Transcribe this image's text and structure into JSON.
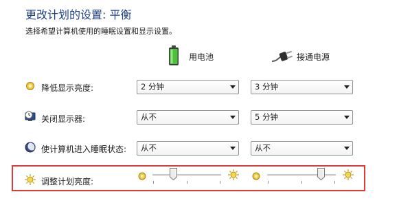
{
  "header": {
    "title": "更改计划的设置: 平衡",
    "subtitle": "选择希望计算机使用的睡眠设置和显示设置。"
  },
  "columns": {
    "battery": {
      "label": "用电池",
      "icon": "battery-icon"
    },
    "plugged": {
      "label": "接通电源",
      "icon": "power-plug-icon"
    }
  },
  "rows": [
    {
      "label": "降低显示亮度:",
      "icon": "dim-display-icon",
      "battery_value": "2 分钟",
      "plugged_value": "3 分钟"
    },
    {
      "label": "关闭显示器:",
      "icon": "display-off-clock-icon",
      "battery_value": "从不",
      "plugged_value": "5 分钟"
    },
    {
      "label": "使计算机进入睡眠状态:",
      "icon": "sleep-moon-icon",
      "battery_value": "从不",
      "plugged_value": "从不"
    }
  ],
  "brightness": {
    "label": "调整计划亮度:",
    "icon": "brightness-sun-icon",
    "battery_level": 0.3,
    "plugged_level": 0.78
  },
  "colors": {
    "title": "#1f3f86",
    "highlight_border": "#e03a3a"
  }
}
